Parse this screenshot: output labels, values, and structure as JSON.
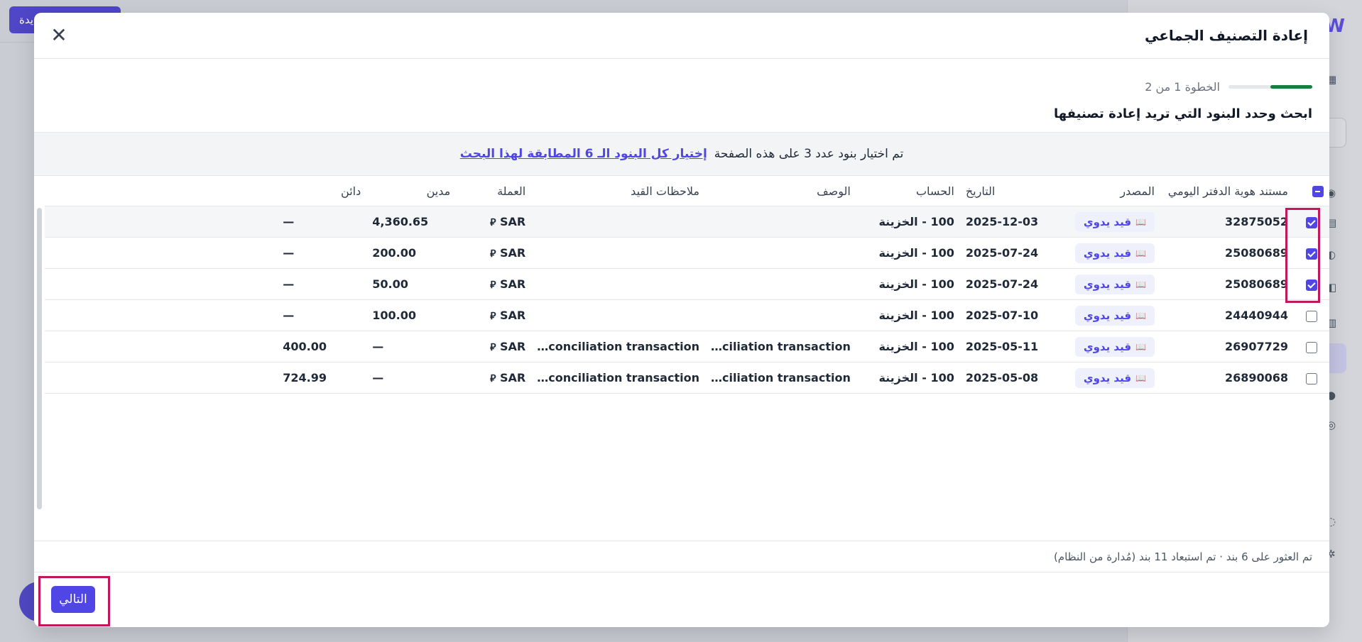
{
  "background": {
    "primary_button_label": "يدة"
  },
  "modal": {
    "title": "إعادة التصنيف الجماعي",
    "step_text": "الخطوة 1 من 2",
    "progress": 0.5,
    "subtitle": "ابحث وحدد البنود التي تريد إعادة تصنيفها",
    "banner_text": "تم اختيار بنود عدد 3 على هذه الصفحة",
    "banner_link": "إختيار كل البنود الـ 6 المطابقة لهذا البحث",
    "columns": {
      "journal_id": "مستند هوية الدفتر اليومي",
      "source": "المصدر",
      "date": "التاريخ",
      "account": "الحساب",
      "description": "الوصف",
      "notes": "ملاحظات القيد",
      "currency": "العملة",
      "debit": "مدين",
      "credit": "دائن"
    },
    "rows": [
      {
        "checked": true,
        "id": "32875052",
        "source": "قيد يدوي",
        "date": "2025-12-03",
        "account": "100 - الخزينة",
        "description": "",
        "notes": "",
        "currency": "SAR",
        "debit": "4,360.65",
        "credit": "—"
      },
      {
        "checked": true,
        "id": "25080689",
        "source": "قيد يدوي",
        "date": "2025-07-24",
        "account": "100 - الخزينة",
        "description": "",
        "notes": "",
        "currency": "SAR",
        "debit": "200.00",
        "credit": "—"
      },
      {
        "checked": true,
        "id": "25080689",
        "source": "قيد يدوي",
        "date": "2025-07-24",
        "account": "100 - الخزينة",
        "description": "",
        "notes": "",
        "currency": "SAR",
        "debit": "50.00",
        "credit": "—"
      },
      {
        "checked": false,
        "id": "24440944",
        "source": "قيد يدوي",
        "date": "2025-07-10",
        "account": "100 - الخزينة",
        "description": "",
        "notes": "",
        "currency": "SAR",
        "debit": "100.00",
        "credit": "—"
      },
      {
        "checked": false,
        "id": "26907729",
        "source": "قيد يدوي",
        "date": "2025-05-11",
        "account": "100 - الخزينة",
        "description": "ciliation transaction…",
        "notes": "conciliation transaction…",
        "currency": "SAR",
        "debit": "—",
        "credit": "400.00"
      },
      {
        "checked": false,
        "id": "26890068",
        "source": "قيد يدوي",
        "date": "2025-05-08",
        "account": "100 - الخزينة",
        "description": "ciliation transaction…",
        "notes": "conciliation transaction…",
        "currency": "SAR",
        "debit": "—",
        "credit": "724.99"
      }
    ],
    "found_text": "تم العثور على 6 بند · تم استبعاد 11 بند (مُدارة من النظام)",
    "next_label": "التالي"
  },
  "icons": {
    "close": "close-icon",
    "source": "book-icon",
    "currency": "riyal-icon"
  },
  "colors": {
    "accent": "#4f46e5",
    "progress": "#15803d",
    "highlight": "#c2185b"
  }
}
